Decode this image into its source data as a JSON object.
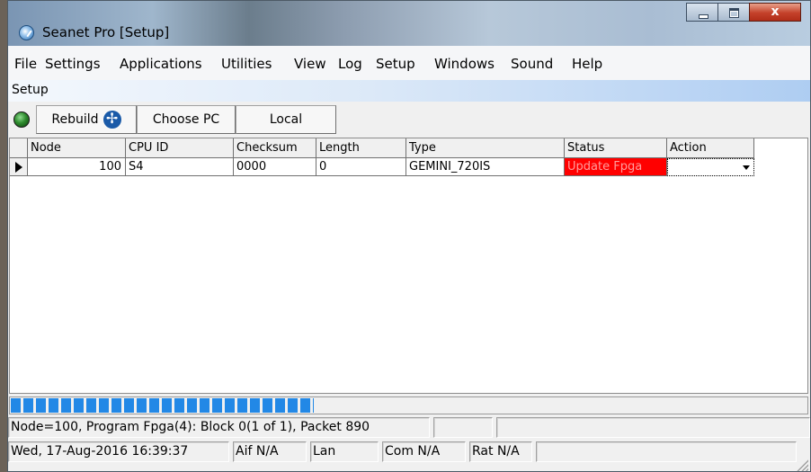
{
  "window": {
    "title": "Seanet Pro [Setup]",
    "close_label": "x"
  },
  "menu": [
    "File",
    "Settings",
    "Applications",
    "Utilities",
    "View",
    "Log",
    "Setup",
    "Windows",
    "Sound",
    "Help"
  ],
  "subheader": "Setup",
  "toolbar": {
    "rebuild_label": "Rebuild",
    "choose_pc_label": "Choose PC",
    "local_label": "Local"
  },
  "table": {
    "columns": [
      "Node",
      "CPU ID",
      "Checksum",
      "Length",
      "Type",
      "Status",
      "Action"
    ],
    "rows": [
      {
        "node": "100",
        "cpu_id": "S4",
        "checksum": "0000",
        "length": "0",
        "type": "GEMINI_720IS",
        "status": "Update Fpga",
        "action": ""
      }
    ]
  },
  "progress": {
    "fraction": 0.38
  },
  "status": {
    "message": "Node=100, Program Fpga(4): Block 0(1 of 1), Packet 890",
    "datetime": "Wed, 17-Aug-2016 16:39:37",
    "aif": "Aif N/A",
    "lan": "Lan",
    "com": "Com N/A",
    "rat": "Rat N/A"
  },
  "colors": {
    "status_error_bg": "#ff0000",
    "progress_fill": "#2288e6"
  }
}
